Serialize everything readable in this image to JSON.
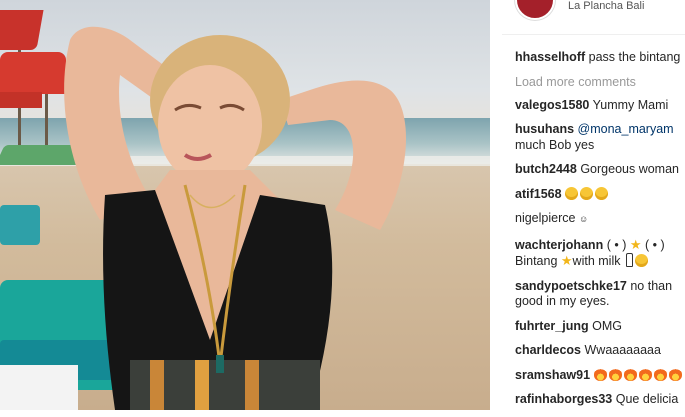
{
  "post": {
    "location": "La Plancha Bali"
  },
  "comments": {
    "load_more_label": "Load more comments",
    "items": [
      {
        "user": "hhasselhoff",
        "text": "pass the bintang"
      },
      {
        "user": "valegos1580",
        "text": "Yummy Mami"
      },
      {
        "user": "husuhans",
        "mention": "@mona_maryam",
        "text": "much Bob yes"
      },
      {
        "user": "butch2448",
        "text": "Gorgeous woman"
      },
      {
        "user": "atif1568",
        "text": ""
      },
      {
        "user": "nigelpierce",
        "text": ""
      },
      {
        "user": "wachterjohann",
        "text": "( • )",
        "text2": "( • )",
        "line2": "Bintang",
        "line2b": "with milk"
      },
      {
        "user": "sandypoetschke17",
        "text": "no than",
        "line2": "good in my eyes."
      },
      {
        "user": "fuhrter_jung",
        "text": "OMG"
      },
      {
        "user": "charldecos",
        "text": "Wwaaaaaaaa"
      },
      {
        "user": "sramshaw91",
        "text": ""
      },
      {
        "user": "rafinhaborges33",
        "text": "Que delicia"
      }
    ]
  },
  "colors": {
    "username": "#262626",
    "muted": "#999999",
    "mention": "#003569",
    "umbrella_red": "#d63a2f",
    "lounger_teal": "#1aa69a"
  },
  "icons": {
    "avatar": "avatar",
    "grin": "grinning-face-icon",
    "star": "star-icon",
    "bottle": "baby-bottle-icon",
    "fire": "fire-icon"
  }
}
